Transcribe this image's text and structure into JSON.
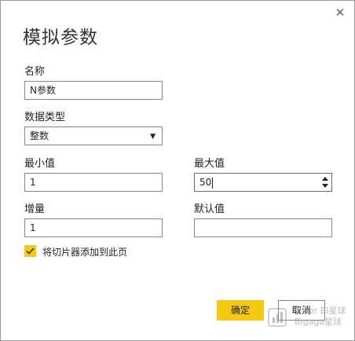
{
  "dialog": {
    "title": "模拟参数",
    "close_glyph": "✕"
  },
  "fields": {
    "name_label": "名称",
    "name_value": "N参数",
    "datatype_label": "数据类型",
    "datatype_value": "整数",
    "min_label": "最小值",
    "min_value": "1",
    "max_label": "最大值",
    "max_value": "50",
    "increment_label": "增量",
    "increment_value": "1",
    "default_label": "默认值",
    "default_value": ""
  },
  "checkbox": {
    "label": "将切片器添加到此页",
    "checked": true
  },
  "buttons": {
    "ok": "确定",
    "cancel": "取消"
  },
  "watermark": {
    "line1": "Power BI星球",
    "line2": "Bigaga星球"
  },
  "colors": {
    "accent": "#f2c811",
    "border": "#8a8886"
  }
}
